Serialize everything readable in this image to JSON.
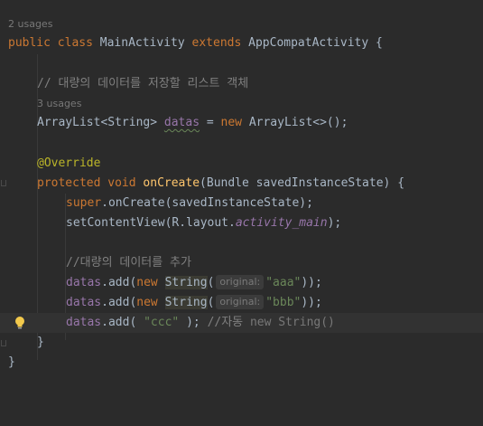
{
  "editor": {
    "class_usages": "2 usages",
    "class_decl": {
      "kw1": "public",
      "kw2": "class",
      "name": "MainActivity",
      "kw3": "extends",
      "parent": "AppCompatActivity",
      "brace": " {"
    },
    "comment1": "// 대량의 데이터를 저장할 리스트 객체",
    "field_usages": "3 usages",
    "field_decl": {
      "type": "ArrayList<String> ",
      "name": "datas",
      "eq": " = ",
      "kw": "new",
      "ctor": " ArrayList<>();"
    },
    "annotation": "@Override",
    "method_decl": {
      "kw1": "protected",
      "kw2": "void",
      "name": "onCreate",
      "params": "(Bundle savedInstanceState) {"
    },
    "super_call": {
      "kw": "super",
      "rest": ".onCreate(savedInstanceState);"
    },
    "set_content": {
      "pre": "setContentView(R.layout.",
      "ital": "activity_main",
      "post": ");"
    },
    "comment2": "//대량의 데이터를 추가",
    "add_lines": [
      {
        "field": "datas",
        "call": ".add(",
        "kw": "new",
        "cls": "String",
        "open": "(",
        "hint": "original:",
        "str": "\"aaa\"",
        "close": "));"
      },
      {
        "field": "datas",
        "call": ".add(",
        "kw": "new",
        "cls": "String",
        "open": "(",
        "hint": "original:",
        "str": "\"bbb\"",
        "close": "));"
      }
    ],
    "auto_line": {
      "field": "datas",
      "call": ".add( ",
      "str": "\"ccc\"",
      "close": " ); ",
      "comment": "//자동 ",
      "ghost": "new String()"
    },
    "method_close": "}",
    "class_close": "}"
  },
  "colors": {
    "background": "#2b2b2b",
    "keyword": "#cc7832",
    "method": "#ffc66d",
    "annotation": "#bbb529",
    "comment": "#808080",
    "string": "#6a8759",
    "field": "#9876aa"
  },
  "icons": {
    "intention_bulb": "lightbulb-icon"
  }
}
